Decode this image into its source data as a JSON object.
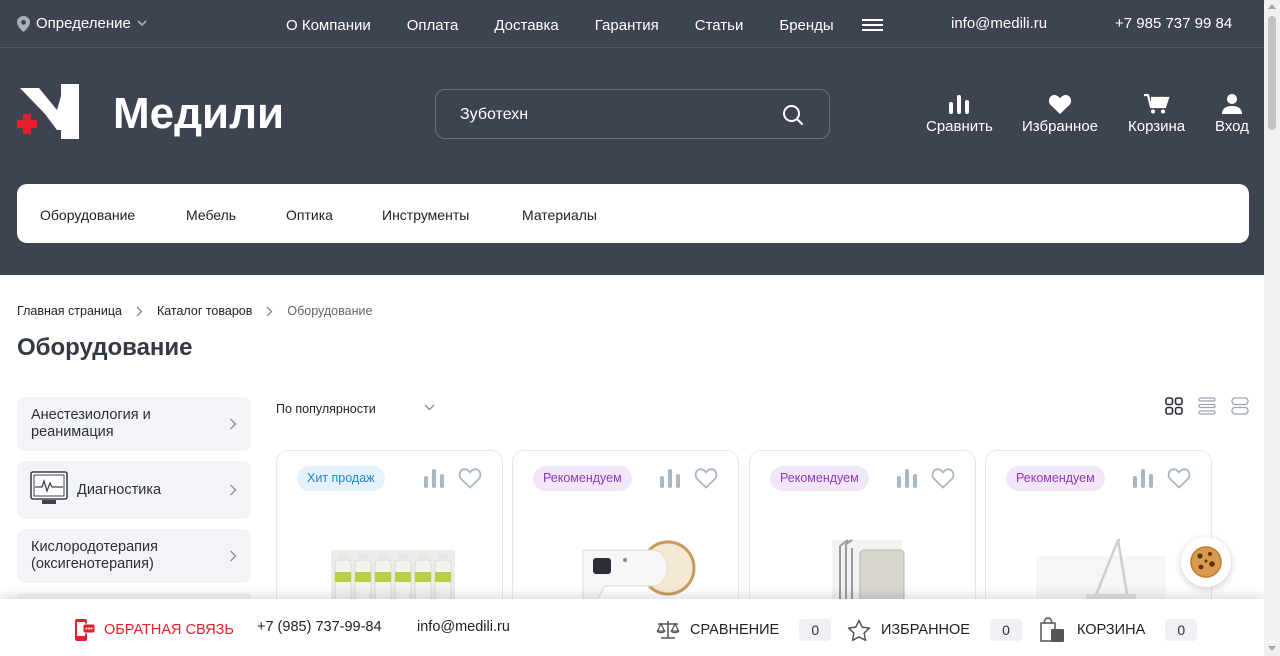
{
  "topbar": {
    "location": "Определение",
    "nav": [
      "О Компании",
      "Оплата",
      "Доставка",
      "Гарантия",
      "Статьи",
      "Бренды"
    ],
    "email": "info@medili.ru",
    "phone": "+7 985 737 99 84"
  },
  "logo": {
    "text": "Медили"
  },
  "search": {
    "value": "Зуботехн"
  },
  "header_actions": {
    "compare": "Сравнить",
    "favorites": "Избранное",
    "cart": "Корзина",
    "login": "Вход"
  },
  "catalog_nav": [
    "Оборудование",
    "Мебель",
    "Оптика",
    "Инструменты",
    "Материалы"
  ],
  "breadcrumbs": [
    "Главная страница",
    "Каталог товаров",
    "Оборудование"
  ],
  "page_title": "Оборудование",
  "sidebar": [
    {
      "label": "Анестезиология и реанимация"
    },
    {
      "label": "Диагностика"
    },
    {
      "label": "Кислородотерапия (оксигенотерапия)"
    }
  ],
  "sort": {
    "selected": "По популярности"
  },
  "products": [
    {
      "badge": "Хит продаж",
      "badge_type": "hit"
    },
    {
      "badge": "Рекомендуем",
      "badge_type": "rec"
    },
    {
      "badge": "Рекомендуем",
      "badge_type": "rec"
    },
    {
      "badge": "Рекомендуем",
      "badge_type": "rec"
    }
  ],
  "bottombar": {
    "feedback": "ОБРАТНАЯ СВЯЗЬ",
    "phone": "+7 (985) 737-99-84",
    "email": "info@medili.ru",
    "compare_label": "СРАВНЕНИЕ",
    "compare_count": "0",
    "favorites_label": "ИЗБРАННОЕ",
    "favorites_count": "0",
    "cart_label": "КОРЗИНА",
    "cart_count": "0"
  },
  "colors": {
    "header_bg": "#3d4350",
    "accent_red": "#e5202d",
    "hit_badge": "#1e88c8",
    "rec_badge": "#8e3ab8"
  }
}
